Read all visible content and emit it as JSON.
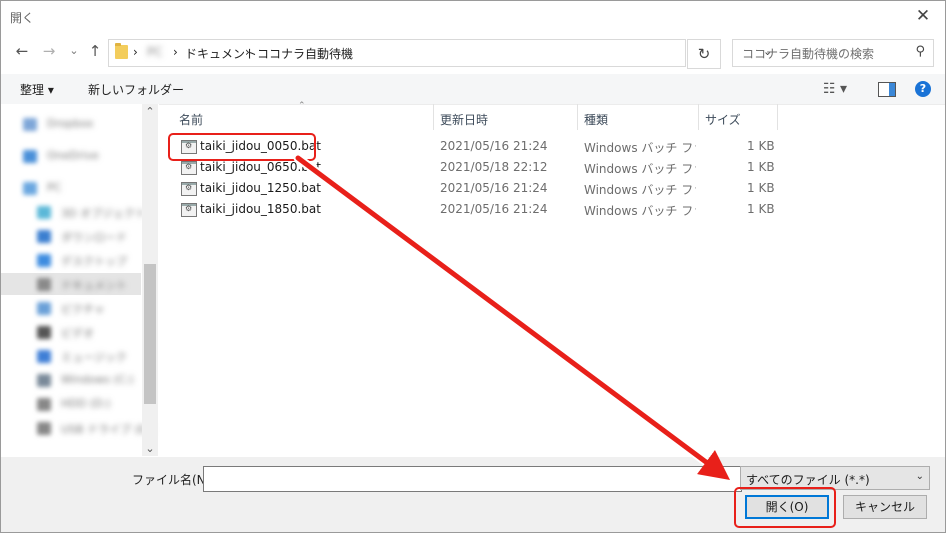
{
  "window": {
    "title": "開く",
    "close_glyph": "✕"
  },
  "nav": {
    "back": "←",
    "forward": "→",
    "history": "⌄",
    "up": "↑"
  },
  "address": {
    "crumbs": [
      "ドキュメント",
      "ココナラ自動待機"
    ],
    "separator": "›",
    "blurred_crumb": "PC",
    "refresh": "↻"
  },
  "search": {
    "placeholder": "ココナラ自動待機の検索"
  },
  "toolbar": {
    "organize": "整理 ▾",
    "new_folder": "新しいフォルダー",
    "help": "?"
  },
  "sidebar": {
    "items": [
      {
        "label": "Dropbox",
        "color": "#7ea6d8"
      },
      {
        "label": "OneDrive",
        "color": "#4a90d9"
      },
      {
        "label": "PC",
        "color": "#6aa7e0"
      },
      {
        "label": "3D オブジェクト",
        "color": "#5bb8d8"
      },
      {
        "label": "ダウンロード",
        "color": "#3b7fd0"
      },
      {
        "label": "デスクトップ",
        "color": "#3d8ce0"
      },
      {
        "label": "ドキュメント",
        "color": "#8a8a8a"
      },
      {
        "label": "ピクチャ",
        "color": "#6aa0d8"
      },
      {
        "label": "ビデオ",
        "color": "#555555"
      },
      {
        "label": "ミュージック",
        "color": "#3f7fd6"
      },
      {
        "label": "Windows (C:)",
        "color": "#7a8a99"
      },
      {
        "label": "HDD (D:)",
        "color": "#888888"
      },
      {
        "label": "USB ドライブ (E:)",
        "color": "#888888"
      }
    ]
  },
  "columns": {
    "name": "名前",
    "date": "更新日時",
    "type": "種類",
    "size": "サイズ"
  },
  "files": [
    {
      "name": "taiki_jidou_0050.bat",
      "date": "2021/05/16 21:24",
      "type": "Windows バッチ ファイル",
      "size": "1 KB"
    },
    {
      "name": "taiki_jidou_0650.bat",
      "date": "2021/05/18 22:12",
      "type": "Windows バッチ ファイル",
      "size": "1 KB"
    },
    {
      "name": "taiki_jidou_1250.bat",
      "date": "2021/05/16 21:24",
      "type": "Windows バッチ ファイル",
      "size": "1 KB"
    },
    {
      "name": "taiki_jidou_1850.bat",
      "date": "2021/05/16 21:24",
      "type": "Windows バッチ ファイル",
      "size": "1 KB"
    }
  ],
  "footer": {
    "filename_label": "ファイル名(N):",
    "filename_value": "",
    "filter": "すべてのファイル (*.*)",
    "open": "開く(O)",
    "cancel": "キャンセル"
  },
  "colors": {
    "annotation": "#e8201a",
    "accent": "#0078d7"
  }
}
